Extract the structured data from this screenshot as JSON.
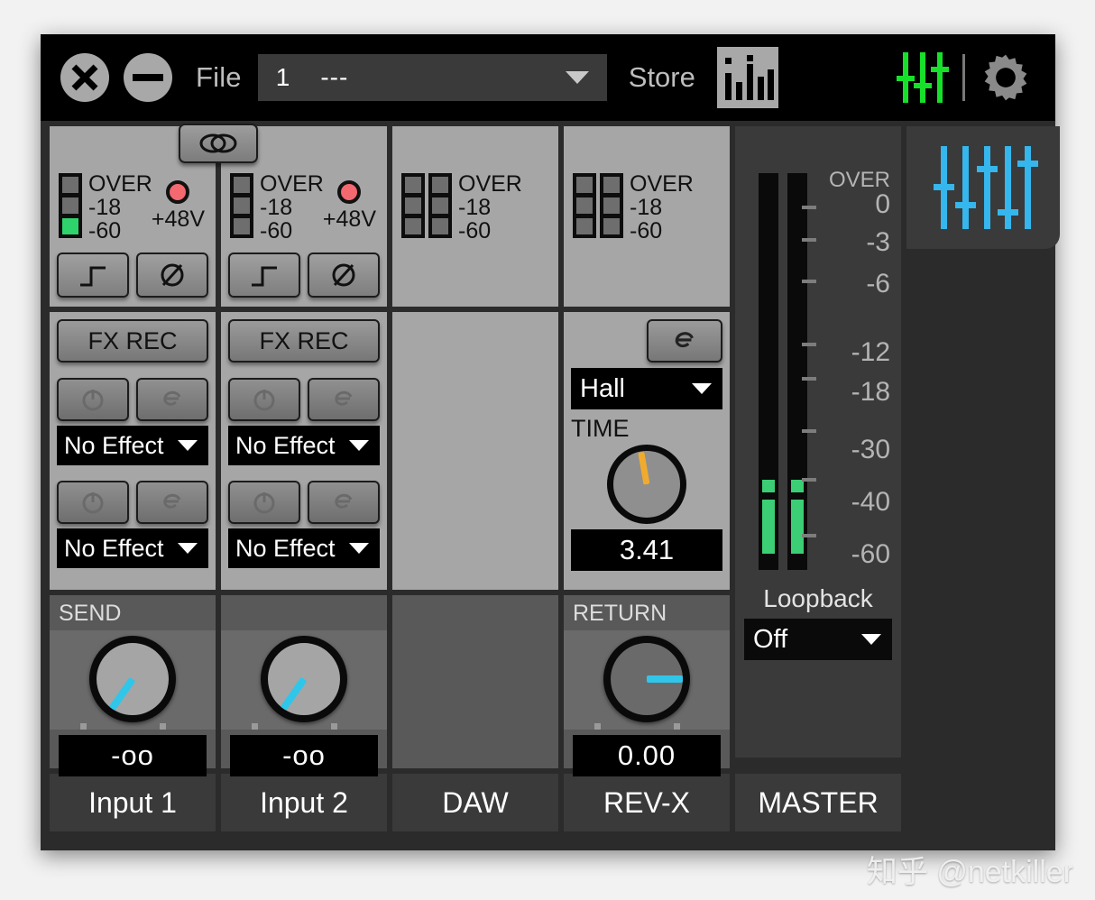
{
  "window": {
    "titlebar": {
      "close_icon": "close-icon",
      "minimize_icon": "minimize-icon",
      "file_label": "File",
      "preset_number": "1",
      "preset_name": "---",
      "store_label": "Store",
      "level_meter_icon": "level-meter-icon",
      "fader_icon_green": "fader-sliders-icon",
      "settings_icon": "gear-icon"
    }
  },
  "channels": [
    {
      "name": "Input 1",
      "meter_labels": [
        "OVER",
        "-18",
        "-60"
      ],
      "meter_leds": [
        "off",
        "off",
        "on"
      ],
      "phantom_label": "+48V",
      "phantom_on": true,
      "hpf_icon": "highpass-filter-icon",
      "phase_icon": "phase-invert-icon",
      "fx_rec_label": "FX REC",
      "fx_slots": [
        {
          "power_icon": "power-icon",
          "edit_icon": "edit-e-icon",
          "effect": "No Effect"
        },
        {
          "power_icon": "power-icon",
          "edit_icon": "edit-e-icon",
          "effect": "No Effect"
        }
      ],
      "send_title": "SEND",
      "send_value": "-oo",
      "send_angle": -145
    },
    {
      "name": "Input 2",
      "meter_labels": [
        "OVER",
        "-18",
        "-60"
      ],
      "meter_leds": [
        "off",
        "off",
        "off"
      ],
      "phantom_label": "+48V",
      "phantom_on": true,
      "hpf_icon": "highpass-filter-icon",
      "phase_icon": "phase-invert-icon",
      "fx_rec_label": "FX REC",
      "fx_slots": [
        {
          "power_icon": "power-icon",
          "edit_icon": "edit-e-icon",
          "effect": "No Effect"
        },
        {
          "power_icon": "power-icon",
          "edit_icon": "edit-e-icon",
          "effect": "No Effect"
        }
      ],
      "send_title": "SEND",
      "send_value": "-oo",
      "send_angle": -145
    },
    {
      "name": "DAW",
      "meter_labels": [
        "OVER",
        "-18",
        "-60"
      ],
      "stereo": true
    },
    {
      "name": "REV-X",
      "meter_labels": [
        "OVER",
        "-18",
        "-60"
      ],
      "stereo": true,
      "edit_icon": "edit-e-icon",
      "reverb_type": "Hall",
      "time_label": "TIME",
      "time_value": "3.41",
      "time_angle": -10,
      "return_title": "RETURN",
      "return_value": "0.00",
      "return_angle": 90
    }
  ],
  "master": {
    "name": "MASTER",
    "scale": [
      "OVER",
      "0",
      "-3",
      "-6",
      "-12",
      "-18",
      "-30",
      "-40",
      "-60"
    ],
    "loopback_label": "Loopback",
    "loopback_value": "Off",
    "fader_icon_blue": "fader-sliders-icon"
  },
  "watermark": "知乎 @netkiller",
  "colors": {
    "accent_blue": "#35b6ec",
    "accent_green": "#17e02a",
    "meter_green": "#3cce74",
    "phantom_red": "#f4686f",
    "knob_orange": "#f0ab2e",
    "panel_grey": "#a6a6a6",
    "dark_bg": "#2b2b2b"
  }
}
